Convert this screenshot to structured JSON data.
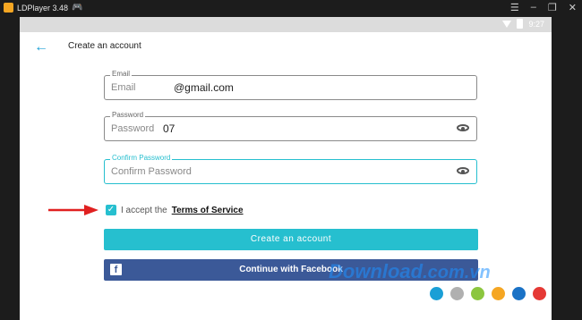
{
  "window": {
    "title": "LDPlayer 3.48"
  },
  "status": {
    "time": "9:27"
  },
  "header": {
    "title": "Create an account"
  },
  "fields": {
    "email": {
      "label": "Email",
      "placeholder": "Email",
      "value": "@gmail.com"
    },
    "password": {
      "label": "Password",
      "placeholder": "Password",
      "value": "07"
    },
    "confirm": {
      "label": "Confirm Password",
      "placeholder": "Confirm Password"
    }
  },
  "terms": {
    "prefix": "I accept the ",
    "link": "Terms of Service",
    "checked": true
  },
  "buttons": {
    "create": "Create an account",
    "facebook": "Continue with Facebook"
  },
  "watermark": {
    "text": "Download",
    "tld": ".com.vn"
  },
  "colors": {
    "accent": "#26bfcf",
    "facebook": "#3b5998",
    "back": "#1a9fd6"
  },
  "dot_colors": [
    "#1a9fd6",
    "#b0b0b0",
    "#8cc63f",
    "#f5a623",
    "#1a72c6",
    "#e53935"
  ]
}
